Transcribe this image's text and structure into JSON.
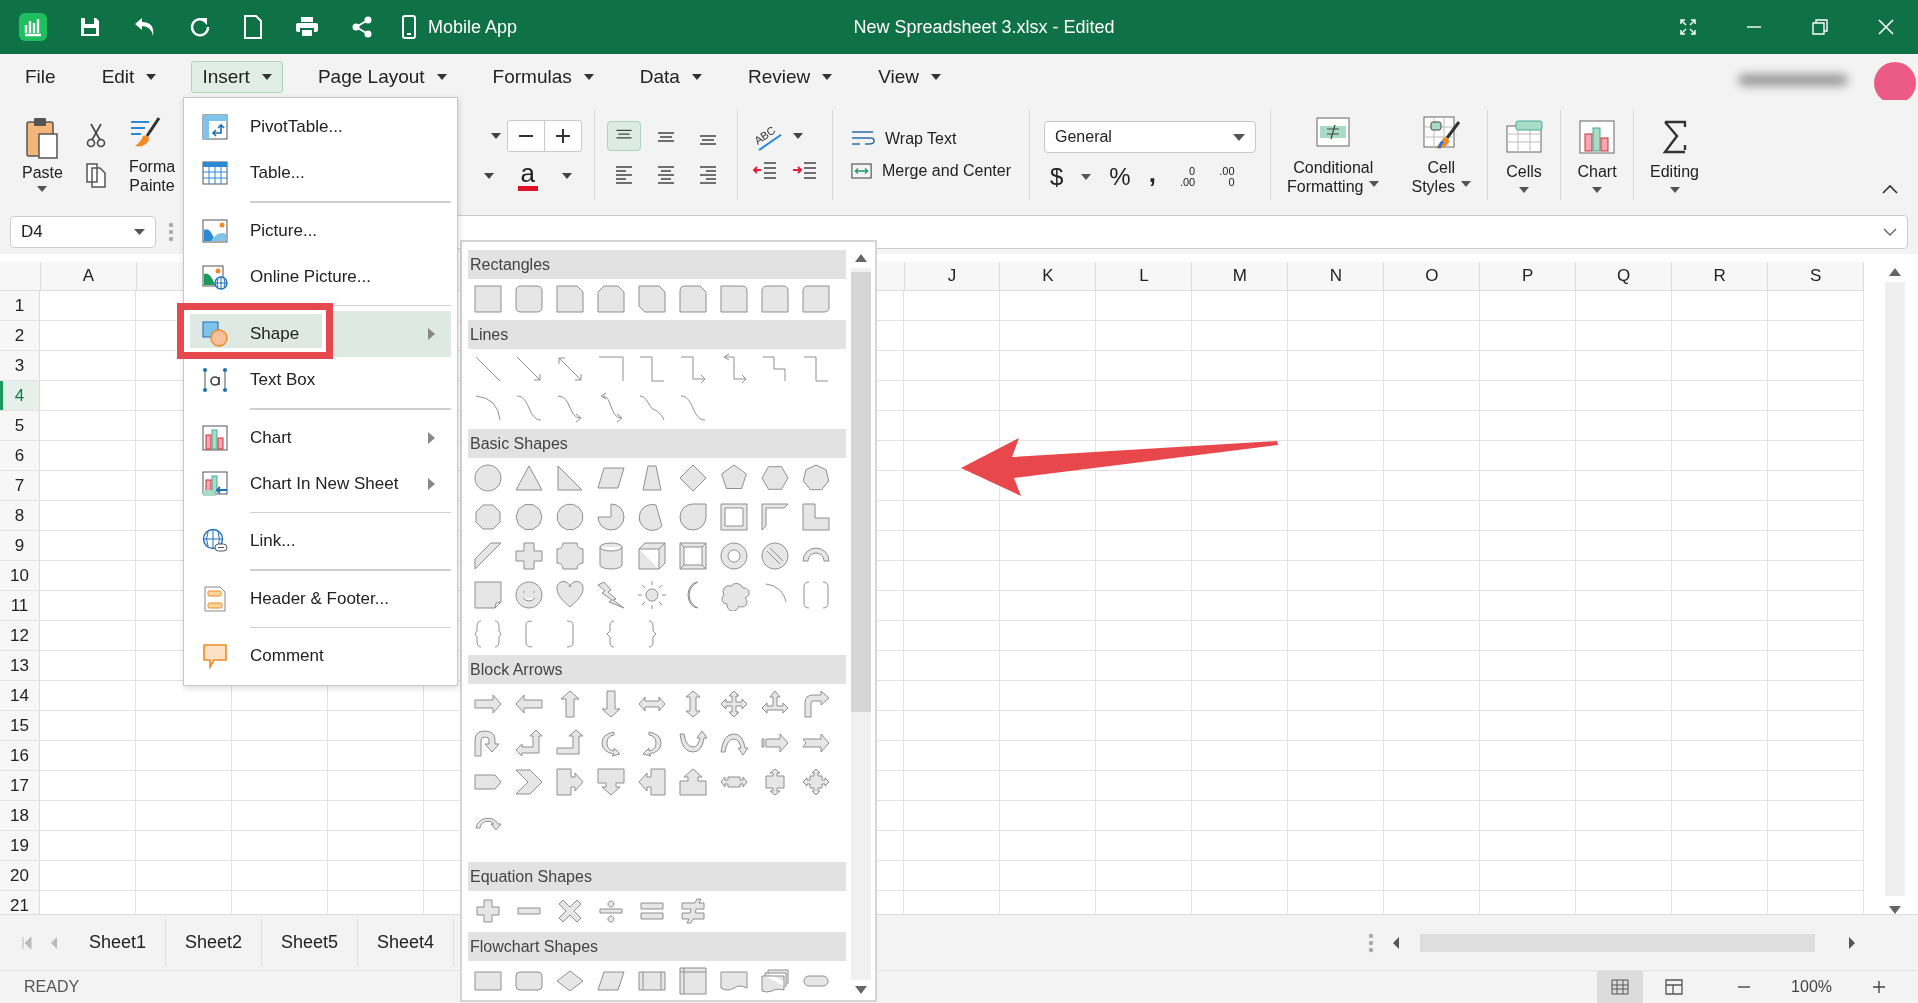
{
  "title_bar": {
    "mobile_app": "Mobile App",
    "title": "New Spreadsheet 3.xlsx - Edited"
  },
  "menu_bar": [
    {
      "label": "File",
      "dropdown": false,
      "selected": false
    },
    {
      "label": "Edit",
      "dropdown": true,
      "selected": false
    },
    {
      "label": "Insert",
      "dropdown": true,
      "selected": true
    },
    {
      "label": "Page Layout",
      "dropdown": true,
      "selected": false
    },
    {
      "label": "Formulas",
      "dropdown": true,
      "selected": false
    },
    {
      "label": "Data",
      "dropdown": true,
      "selected": false
    },
    {
      "label": "Review",
      "dropdown": true,
      "selected": false
    },
    {
      "label": "View",
      "dropdown": true,
      "selected": false
    }
  ],
  "ribbon": {
    "paste": "Paste",
    "format_painter": [
      "Forma",
      "Painte"
    ],
    "font_color_glyph": "a",
    "orientation_glyph": "ABC",
    "alignment": [
      {
        "kind": "top",
        "selected": true
      },
      {
        "kind": "middle",
        "selected": false
      },
      {
        "kind": "bottom",
        "selected": false
      },
      {
        "kind": "left",
        "selected": false
      },
      {
        "kind": "center",
        "selected": false
      },
      {
        "kind": "right",
        "selected": false
      }
    ],
    "wrap_text": "Wrap Text",
    "merge_center": "Merge and Center",
    "number_format": "General",
    "number_buttons": [
      {
        "kind": "currency",
        "glyph": "$",
        "dropdown": true
      },
      {
        "kind": "percent",
        "glyph": "%",
        "dropdown": false
      },
      {
        "kind": "comma",
        "glyph": ",",
        "dropdown": false
      },
      {
        "kind": "increase-decimal",
        "lines": [
          "0",
          ".00"
        ],
        "dropdown": false
      },
      {
        "kind": "decrease-decimal",
        "lines": [
          ".00",
          "0"
        ],
        "dropdown": false
      }
    ],
    "commands": [
      {
        "kind": "conditional-formatting",
        "lines": [
          "Conditional",
          "Formatting"
        ]
      },
      {
        "kind": "cell-styles",
        "lines": [
          "Cell",
          "Styles"
        ]
      },
      {
        "kind": "cells",
        "lines": [
          "Cells"
        ]
      },
      {
        "kind": "chart",
        "lines": [
          "Chart"
        ]
      },
      {
        "kind": "editing",
        "lines": [
          "Editing"
        ]
      }
    ]
  },
  "formula_bar": {
    "name_box": "D4"
  },
  "grid": {
    "column_headers_left": [
      "A"
    ],
    "column_headers_right": [
      "J",
      "K",
      "L",
      "M",
      "N",
      "O",
      "P",
      "Q",
      "R",
      "S"
    ],
    "rows": [
      {
        "label": "1",
        "selected": false
      },
      {
        "label": "2",
        "selected": false
      },
      {
        "label": "3",
        "selected": false
      },
      {
        "label": "4",
        "selected": true
      },
      {
        "label": "5",
        "selected": false
      },
      {
        "label": "6",
        "selected": false
      },
      {
        "label": "7",
        "selected": false
      },
      {
        "label": "8",
        "selected": false
      },
      {
        "label": "9",
        "selected": false
      },
      {
        "label": "10",
        "selected": false
      },
      {
        "label": "11",
        "selected": false
      },
      {
        "label": "12",
        "selected": false
      },
      {
        "label": "13",
        "selected": false
      },
      {
        "label": "14",
        "selected": false
      },
      {
        "label": "15",
        "selected": false
      },
      {
        "label": "16",
        "selected": false
      },
      {
        "label": "17",
        "selected": false
      },
      {
        "label": "18",
        "selected": false
      },
      {
        "label": "19",
        "selected": false
      },
      {
        "label": "20",
        "selected": false
      },
      {
        "label": "21",
        "selected": false
      }
    ]
  },
  "sheet_tabs": [
    "Sheet1",
    "Sheet2",
    "Sheet5",
    "Sheet4"
  ],
  "status_bar": {
    "status": "READY",
    "views": [
      {
        "kind": "normal",
        "selected": true
      },
      {
        "kind": "page-layout",
        "selected": false
      }
    ],
    "zoom": "100%"
  },
  "insert_menu": {
    "groups": [
      [
        {
          "label": "PivotTable...",
          "kind": "pivot-table",
          "submenu": false,
          "selected": false
        },
        {
          "label": "Table...",
          "kind": "table",
          "submenu": false,
          "selected": false
        }
      ],
      [
        {
          "label": "Picture...",
          "kind": "picture",
          "submenu": false,
          "selected": false
        },
        {
          "label": "Online Picture...",
          "kind": "online-picture",
          "submenu": false,
          "selected": false
        }
      ],
      [
        {
          "label": "Shape",
          "kind": "shape",
          "submenu": true,
          "selected": true
        },
        {
          "label": "Text Box",
          "kind": "text-box",
          "submenu": false,
          "selected": false
        }
      ],
      [
        {
          "label": "Chart",
          "kind": "chart",
          "submenu": true,
          "selected": false
        },
        {
          "label": "Chart In New Sheet",
          "kind": "chart-sheet",
          "submenu": true,
          "selected": false
        }
      ],
      [
        {
          "label": "Link...",
          "kind": "link",
          "submenu": false,
          "selected": false
        }
      ],
      [
        {
          "label": "Header & Footer...",
          "kind": "header-footer",
          "submenu": false,
          "selected": false
        }
      ],
      [
        {
          "label": "Comment",
          "kind": "comment",
          "submenu": false,
          "selected": false
        }
      ]
    ]
  },
  "shape_gallery": {
    "sections": [
      {
        "title": "Rectangles",
        "rows": [
          [
            {
              "kind": "rectangle"
            },
            {
              "kind": "rounded-rectangle"
            },
            {
              "kind": "snipped-rectangle"
            },
            {
              "kind": "double-snipped-rectangle"
            },
            {
              "kind": "diagonal-snipped-rectangle"
            },
            {
              "kind": "snipped-rounded-rectangle"
            },
            {
              "kind": "one-round-rectangle"
            },
            {
              "kind": "two-round-rectangle"
            },
            {
              "kind": "diagonal-round-rectangle"
            }
          ]
        ]
      },
      {
        "title": "Lines",
        "rows": [
          [
            {
              "kind": "straight-line"
            },
            {
              "kind": "arrow-line"
            },
            {
              "kind": "double-arrow-line"
            },
            {
              "kind": "elbow-line"
            },
            {
              "kind": "elbow-connector"
            },
            {
              "kind": "elbow-arrow-connector"
            },
            {
              "kind": "elbow-double-arrow-connector"
            },
            {
              "kind": "step-line"
            },
            {
              "kind": "elbow-connector"
            }
          ],
          [
            {
              "kind": "curve-line"
            },
            {
              "kind": "s-curve-line"
            },
            {
              "kind": "s-curve-arrow"
            },
            {
              "kind": "s-curve-double-arrow"
            },
            {
              "kind": "wave-line"
            },
            {
              "kind": "s-curve-line"
            }
          ]
        ]
      },
      {
        "title": "Basic Shapes",
        "rows": [
          [
            {
              "kind": "circle"
            },
            {
              "kind": "triangle"
            },
            {
              "kind": "right-triangle"
            },
            {
              "kind": "parallelogram"
            },
            {
              "kind": "trapezoid"
            },
            {
              "kind": "diamond"
            },
            {
              "kind": "pentagon"
            },
            {
              "kind": "hexagon"
            },
            {
              "kind": "heptagon"
            }
          ],
          [
            {
              "kind": "octagon"
            },
            {
              "kind": "decagon"
            },
            {
              "kind": "dodecagon"
            },
            {
              "kind": "pie"
            },
            {
              "kind": "chord"
            },
            {
              "kind": "teardrop"
            },
            {
              "kind": "frame"
            },
            {
              "kind": "half-frame"
            },
            {
              "kind": "l-shape"
            }
          ],
          [
            {
              "kind": "diagonal-stripe"
            },
            {
              "kind": "cross"
            },
            {
              "kind": "plaque"
            },
            {
              "kind": "cylinder"
            },
            {
              "kind": "cube"
            },
            {
              "kind": "bevel"
            },
            {
              "kind": "donut"
            },
            {
              "kind": "no-symbol"
            },
            {
              "kind": "block-arc"
            }
          ],
          [
            {
              "kind": "folded-corner"
            },
            {
              "kind": "smiley"
            },
            {
              "kind": "heart"
            },
            {
              "kind": "lightning"
            },
            {
              "kind": "sun"
            },
            {
              "kind": "moon"
            },
            {
              "kind": "cloud"
            },
            {
              "kind": "arc"
            },
            {
              "kind": "bracket-pair"
            }
          ],
          [
            {
              "kind": "brace-pair"
            },
            {
              "kind": "left-bracket"
            },
            {
              "kind": "right-bracket"
            },
            {
              "kind": "left-brace"
            },
            {
              "kind": "right-brace"
            }
          ]
        ]
      },
      {
        "title": "Block Arrows",
        "rows": [
          [
            {
              "kind": "right-arrow"
            },
            {
              "kind": "left-arrow"
            },
            {
              "kind": "up-arrow"
            },
            {
              "kind": "down-arrow"
            },
            {
              "kind": "left-right-arrow"
            },
            {
              "kind": "up-down-arrow"
            },
            {
              "kind": "quad-arrow"
            },
            {
              "kind": "left-right-up-arrow"
            },
            {
              "kind": "bent-arrow"
            }
          ],
          [
            {
              "kind": "u-turn-arrow"
            },
            {
              "kind": "left-up-arrow"
            },
            {
              "kind": "bent-up-arrow"
            },
            {
              "kind": "curved-right-arrow"
            },
            {
              "kind": "curved-left-arrow"
            },
            {
              "kind": "curved-up-arrow"
            },
            {
              "kind": "curved-down-arrow"
            },
            {
              "kind": "striped-right-arrow"
            },
            {
              "kind": "notched-right-arrow"
            }
          ],
          [
            {
              "kind": "pentagon-arrow"
            },
            {
              "kind": "chevron"
            },
            {
              "kind": "right-arrow-callout"
            },
            {
              "kind": "down-arrow-callout"
            },
            {
              "kind": "left-arrow-callout"
            },
            {
              "kind": "up-arrow-callout"
            },
            {
              "kind": "left-right-arrow-callout"
            },
            {
              "kind": "up-down-arrow-callout"
            },
            {
              "kind": "quad-arrow-callout"
            }
          ],
          [
            {
              "kind": "circular-arrow"
            }
          ]
        ]
      },
      {
        "title": "Equation Shapes",
        "rows": [
          [
            {
              "kind": "plus"
            },
            {
              "kind": "minus"
            },
            {
              "kind": "multiply"
            },
            {
              "kind": "divide"
            },
            {
              "kind": "equal"
            },
            {
              "kind": "not-equal"
            }
          ]
        ]
      },
      {
        "title": "Flowchart Shapes",
        "rows": [
          [
            {
              "kind": "process"
            },
            {
              "kind": "alternate-process"
            },
            {
              "kind": "decision"
            },
            {
              "kind": "data"
            },
            {
              "kind": "predefined-process"
            },
            {
              "kind": "internal-storage"
            },
            {
              "kind": "document"
            },
            {
              "kind": "multidocument"
            },
            {
              "kind": "terminator"
            }
          ]
        ]
      }
    ]
  }
}
